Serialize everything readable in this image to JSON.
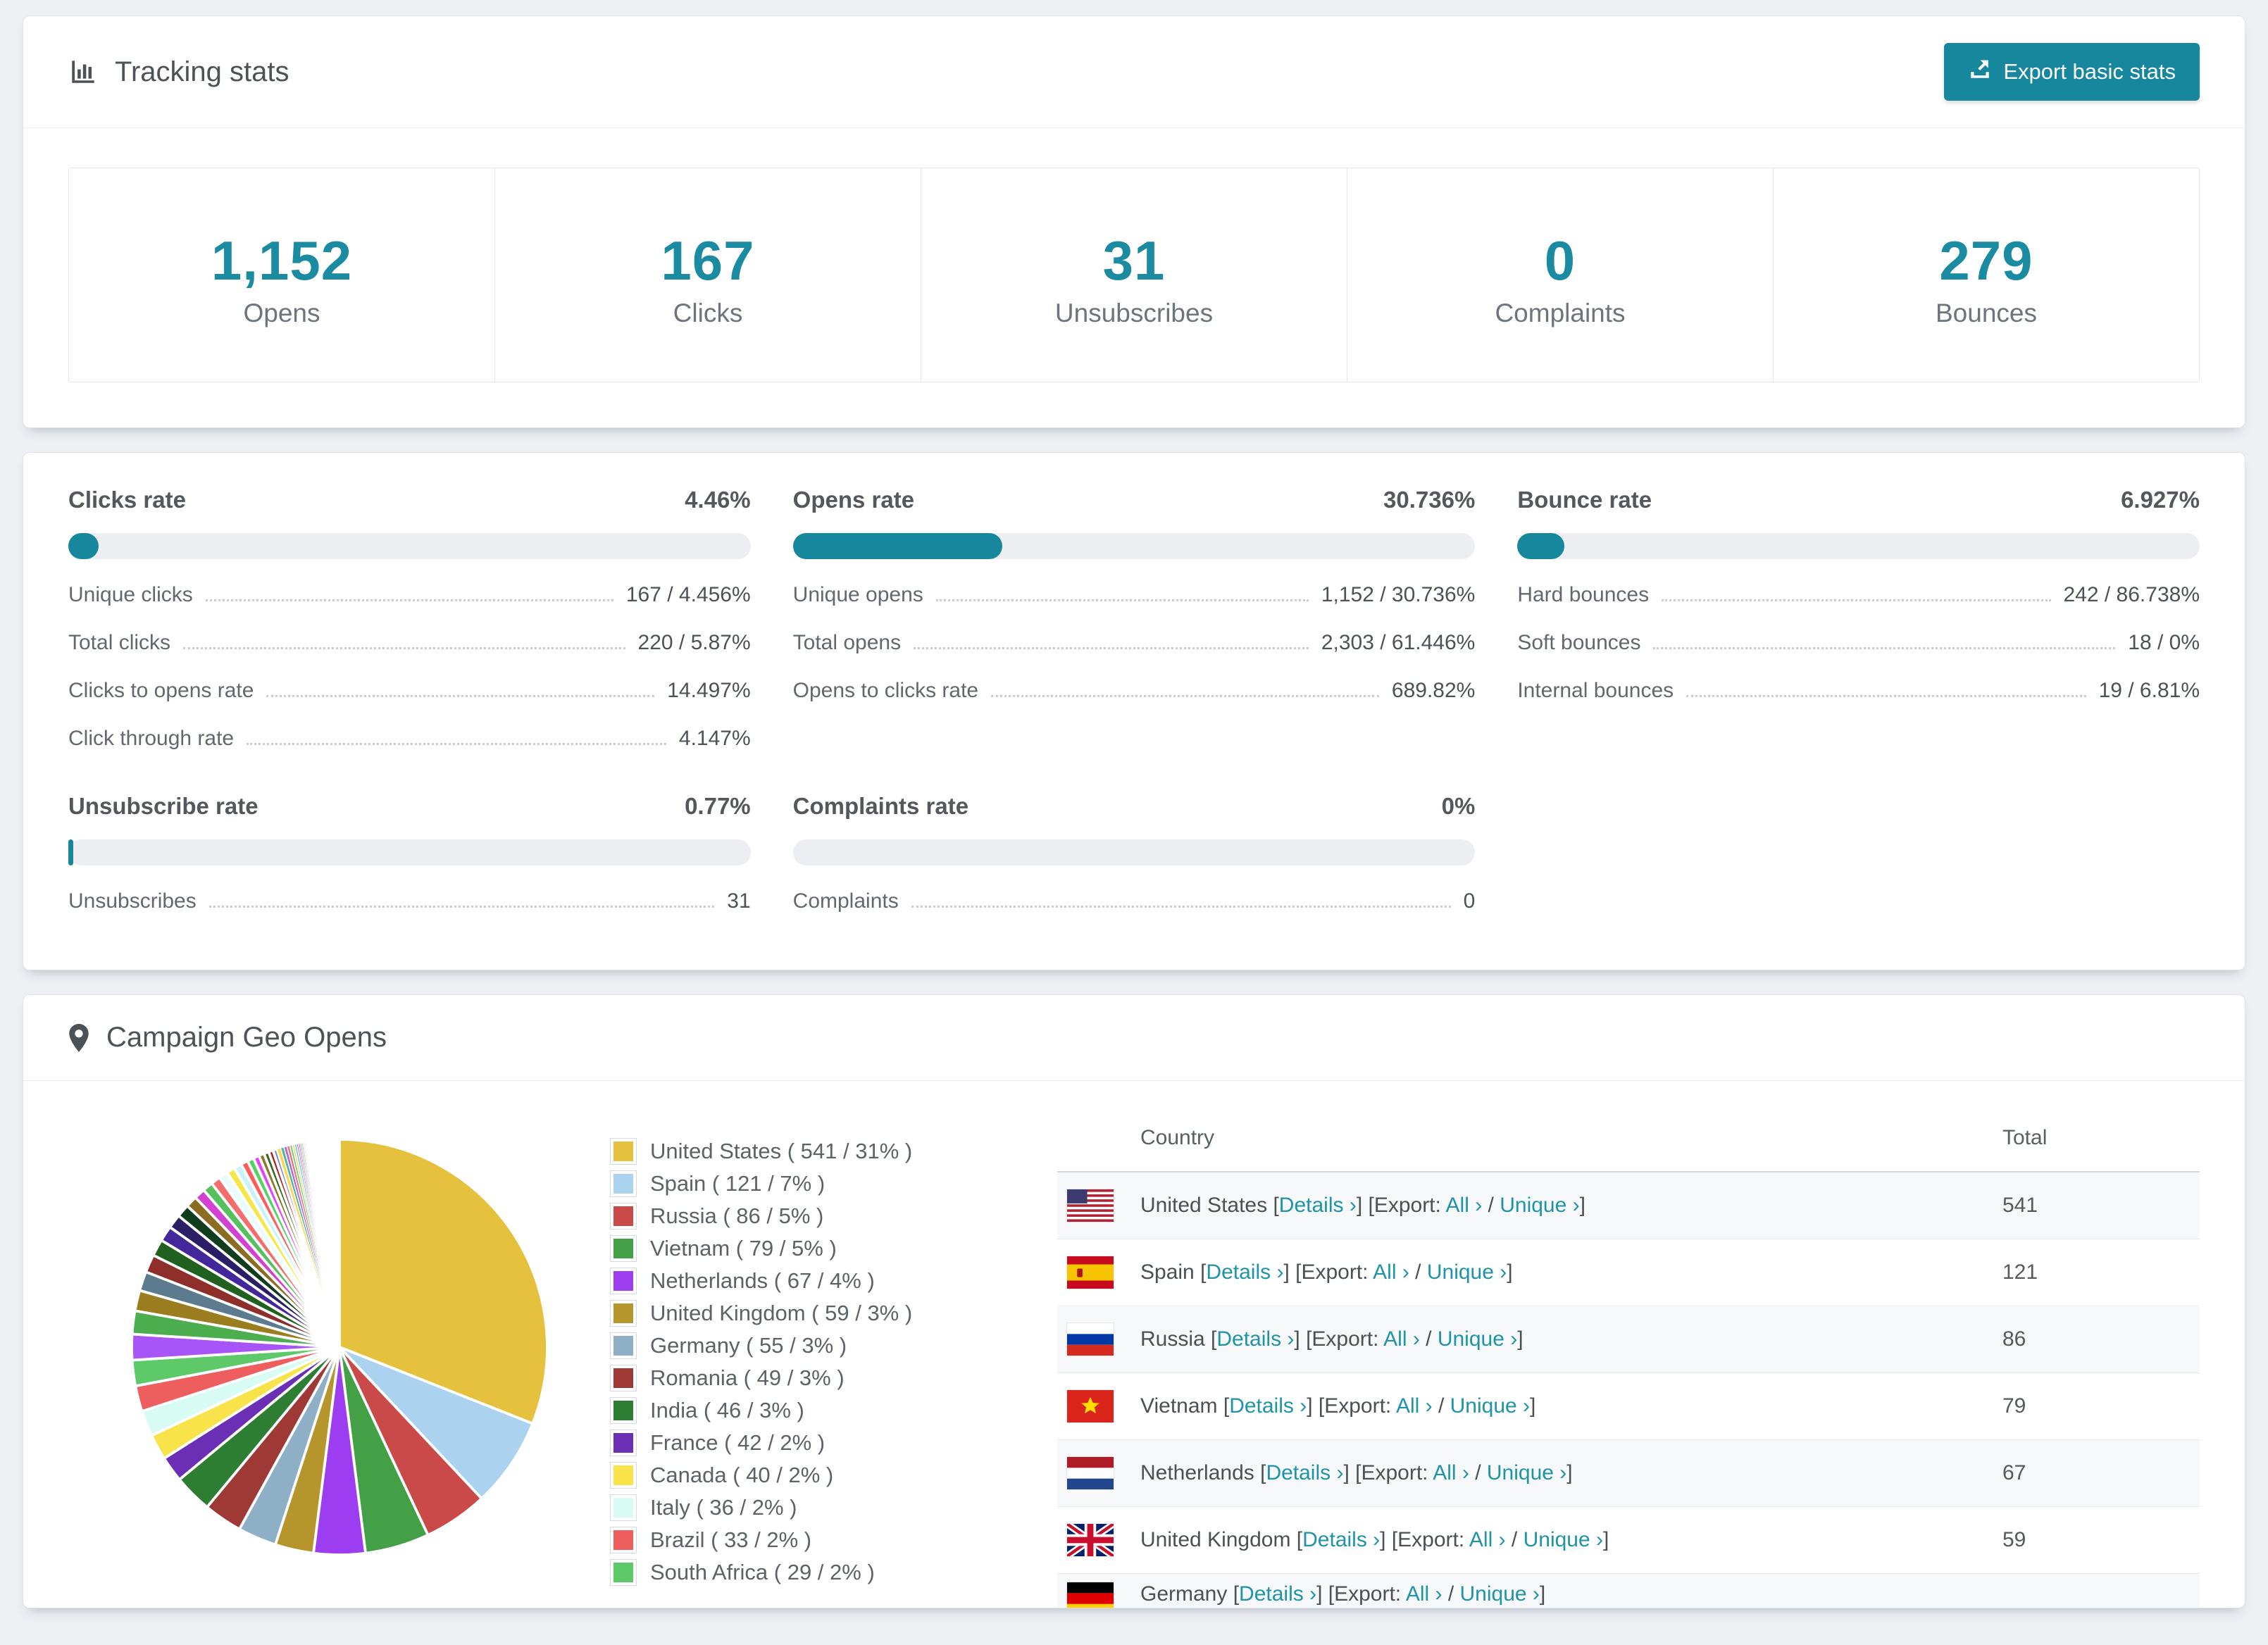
{
  "theme": {
    "accent": "#17879d",
    "link": "#1e93a9",
    "stat_number": "#1a8ba0",
    "bar_track": "#eceef2"
  },
  "tracking": {
    "title": "Tracking stats",
    "export_label": "Export basic stats",
    "stats": [
      {
        "value": "1,152",
        "label": "Opens"
      },
      {
        "value": "167",
        "label": "Clicks"
      },
      {
        "value": "31",
        "label": "Unsubscribes"
      },
      {
        "value": "0",
        "label": "Complaints"
      },
      {
        "value": "279",
        "label": "Bounces"
      }
    ]
  },
  "rates": [
    {
      "title": "Clicks rate",
      "value": "4.46%",
      "pct": 4.46,
      "rows": [
        {
          "label": "Unique clicks",
          "value": "167 / 4.456%"
        },
        {
          "label": "Total clicks",
          "value": "220 / 5.87%"
        },
        {
          "label": "Clicks to opens rate",
          "value": "14.497%"
        },
        {
          "label": "Click through rate",
          "value": "4.147%"
        }
      ]
    },
    {
      "title": "Opens rate",
      "value": "30.736%",
      "pct": 30.736,
      "rows": [
        {
          "label": "Unique opens",
          "value": "1,152 / 30.736%"
        },
        {
          "label": "Total opens",
          "value": "2,303 / 61.446%"
        },
        {
          "label": "Opens to clicks rate",
          "value": "689.82%"
        }
      ]
    },
    {
      "title": "Bounce rate",
      "value": "6.927%",
      "pct": 6.927,
      "rows": [
        {
          "label": "Hard bounces",
          "value": "242 / 86.738%"
        },
        {
          "label": "Soft bounces",
          "value": "18 / 0%"
        },
        {
          "label": "Internal bounces",
          "value": "19 / 6.81%"
        }
      ]
    },
    {
      "title": "Unsubscribe rate",
      "value": "0.77%",
      "pct": 0.77,
      "rows": [
        {
          "label": "Unsubscribes",
          "value": "31"
        }
      ]
    },
    {
      "title": "Complaints rate",
      "value": "0%",
      "pct": 0,
      "rows": [
        {
          "label": "Complaints",
          "value": "0"
        }
      ]
    }
  ],
  "geo": {
    "title": "Campaign Geo Opens",
    "headers": [
      "Country",
      "Total"
    ],
    "links": {
      "details": "Details ›",
      "export_prefix": "Export:",
      "all": "All ›",
      "unique": "Unique ›"
    },
    "rows": [
      {
        "country": "United States",
        "total": "541",
        "flag": "us"
      },
      {
        "country": "Spain",
        "total": "121",
        "flag": "es"
      },
      {
        "country": "Russia",
        "total": "86",
        "flag": "ru"
      },
      {
        "country": "Vietnam",
        "total": "79",
        "flag": "vn"
      },
      {
        "country": "Netherlands",
        "total": "67",
        "flag": "nl"
      },
      {
        "country": "United Kingdom",
        "total": "59",
        "flag": "gb"
      },
      {
        "country": "Germany",
        "total": "",
        "flag": "de",
        "cut": true
      }
    ]
  },
  "chart_data": {
    "type": "pie",
    "title": "Campaign Geo Opens",
    "legend_position": "right",
    "series": [
      {
        "label": "United States",
        "count": 541,
        "pct": 31,
        "color": "#e6c13d"
      },
      {
        "label": "Spain",
        "count": 121,
        "pct": 7,
        "color": "#abd3f0"
      },
      {
        "label": "Russia",
        "count": 86,
        "pct": 5,
        "color": "#c94a48"
      },
      {
        "label": "Vietnam",
        "count": 79,
        "pct": 5,
        "color": "#43a047"
      },
      {
        "label": "Netherlands",
        "count": 67,
        "pct": 4,
        "color": "#9c3df2"
      },
      {
        "label": "United Kingdom",
        "count": 59,
        "pct": 3,
        "color": "#b6952c"
      },
      {
        "label": "Germany",
        "count": 55,
        "pct": 3,
        "color": "#8fafc6"
      },
      {
        "label": "Romania",
        "count": 49,
        "pct": 3,
        "color": "#9e3935"
      },
      {
        "label": "India",
        "count": 46,
        "pct": 3,
        "color": "#2d7d32"
      },
      {
        "label": "France",
        "count": 42,
        "pct": 2,
        "color": "#6a2fb5"
      },
      {
        "label": "Canada",
        "count": 40,
        "pct": 2,
        "color": "#f8e34a"
      },
      {
        "label": "Italy",
        "count": 36,
        "pct": 2,
        "color": "#d8fbf4"
      },
      {
        "label": "Brazil",
        "count": 33,
        "pct": 2,
        "color": "#ef5e5e"
      },
      {
        "label": "South Africa",
        "count": 29,
        "pct": 2,
        "color": "#5ec968"
      }
    ],
    "other_slices": [
      {
        "pct": 2.0,
        "color": "#a855f7"
      },
      {
        "pct": 1.8,
        "color": "#4cae4f"
      },
      {
        "pct": 1.6,
        "color": "#9a7d1e"
      },
      {
        "pct": 1.5,
        "color": "#5d7b8e"
      },
      {
        "pct": 1.4,
        "color": "#8e2f2b"
      },
      {
        "pct": 1.3,
        "color": "#20611f"
      },
      {
        "pct": 1.2,
        "color": "#43289c"
      },
      {
        "pct": 1.1,
        "color": "#2a1f66"
      },
      {
        "pct": 1.0,
        "color": "#0f3d1e"
      },
      {
        "pct": 0.9,
        "color": "#8a6d22"
      },
      {
        "pct": 0.85,
        "color": "#d241d2"
      },
      {
        "pct": 0.8,
        "color": "#57c05e"
      },
      {
        "pct": 0.75,
        "color": "#f56c6c"
      },
      {
        "pct": 0.7,
        "color": "#eafcff"
      },
      {
        "pct": 0.65,
        "color": "#f6e649"
      },
      {
        "pct": 0.6,
        "color": "#c9f3fb"
      },
      {
        "pct": 0.55,
        "color": "#ff5b5b"
      },
      {
        "pct": 0.5,
        "color": "#53d366"
      },
      {
        "pct": 0.46,
        "color": "#e341fb"
      },
      {
        "pct": 0.42,
        "color": "#8f772a"
      },
      {
        "pct": 0.38,
        "color": "#33691e"
      },
      {
        "pct": 0.35,
        "color": "#b71c1c"
      },
      {
        "pct": 0.32,
        "color": "#7986cb"
      },
      {
        "pct": 0.29,
        "color": "#ffd54f"
      },
      {
        "pct": 0.26,
        "color": "#4db6ac"
      },
      {
        "pct": 0.24,
        "color": "#ba68c8"
      },
      {
        "pct": 0.22,
        "color": "#e57373"
      },
      {
        "pct": 0.2,
        "color": "#81c784"
      },
      {
        "pct": 0.18,
        "color": "#dce775"
      },
      {
        "pct": 0.16,
        "color": "#4fc3f7"
      },
      {
        "pct": 0.14,
        "color": "#f06292"
      },
      {
        "pct": 0.13,
        "color": "#9575cd"
      },
      {
        "pct": 0.12,
        "color": "#a1887f"
      },
      {
        "pct": 0.11,
        "color": "#90a4ae"
      },
      {
        "pct": 0.1,
        "color": "#aed581"
      },
      {
        "pct": 0.09,
        "color": "#ffb74d"
      },
      {
        "pct": 0.08,
        "color": "#4dd0e1"
      }
    ]
  }
}
